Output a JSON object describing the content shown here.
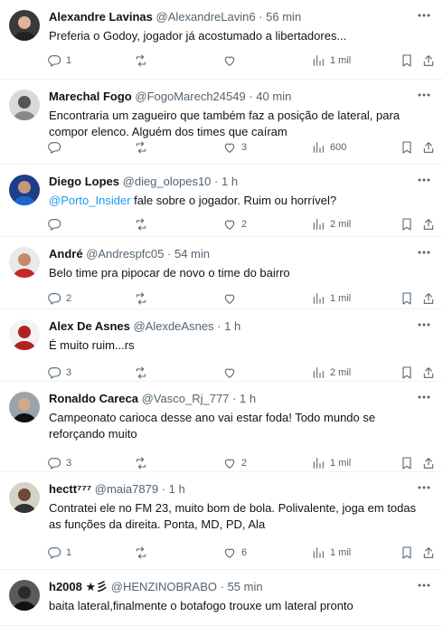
{
  "replies": [
    {
      "name": "Alexandre Lavinas",
      "handle": "@AlexandreLavin6",
      "time": "56 min",
      "text": "Preferia o Godoy, jogador já acostumado a libertadores...",
      "replies": "1",
      "reposts": "",
      "likes": "",
      "views": "1 mil"
    },
    {
      "name": "Marechal Fogo",
      "handle": "@FogoMarech24549",
      "time": "40 min",
      "text": "Encontraria um zagueiro que também faz a posição de lateral, para compor elenco. Alguém dos times que caíram",
      "replies": "",
      "reposts": "",
      "likes": "3",
      "views": "600"
    },
    {
      "name": "Diego Lopes",
      "handle": "@dieg_olopes10",
      "time": "1 h",
      "mention": "@Porto_Insider",
      "text": " fale sobre o jogador. Ruim ou horrível?",
      "replies": "",
      "reposts": "",
      "likes": "2",
      "views": "2 mil"
    },
    {
      "name": "André",
      "handle": "@Andrespfc05",
      "time": "54 min",
      "text": "Belo time pra pipocar de novo o time do bairro",
      "replies": "2",
      "reposts": "",
      "likes": "",
      "views": "1 mil"
    },
    {
      "name": "Alex De Asnes",
      "handle": "@AlexdeAsnes",
      "time": "1 h",
      "text": "É muito ruim...rs",
      "replies": "3",
      "reposts": "",
      "likes": "",
      "views": "2 mil"
    },
    {
      "name": "Ronaldo Careca",
      "handle": "@Vasco_Rj_777",
      "time": "1 h",
      "text": "Campeonato carioca desse ano vai estar foda! Todo mundo se reforçando muito",
      "replies": "3",
      "reposts": "",
      "likes": "2",
      "views": "1 mil"
    },
    {
      "name": "hectt⁷⁷⁷",
      "handle": "@maia7879",
      "time": "1 h",
      "text": "Contratei ele no FM 23, muito bom de bola. Polivalente, joga em todas as funções da direita. Ponta, MD, PD, Ala",
      "replies": "1",
      "reposts": "",
      "likes": "6",
      "views": "1 mil"
    },
    {
      "name": "h2008 ★彡",
      "handle": "@HENZINOBRABO",
      "time": "55 min",
      "text": "baita lateral,finalmente o botafogo trouxe um lateral pronto",
      "replies": "",
      "reposts": "",
      "likes": "",
      "views": ""
    }
  ],
  "separator": "·",
  "colors": {
    "text": "#0f1419",
    "secondary": "#536471",
    "mention": "#1d9bf0",
    "divider": "#eff3f4"
  },
  "icons": [
    "reply-icon",
    "repost-icon",
    "like-icon",
    "views-icon",
    "bookmark-icon",
    "share-icon",
    "more-icon"
  ]
}
